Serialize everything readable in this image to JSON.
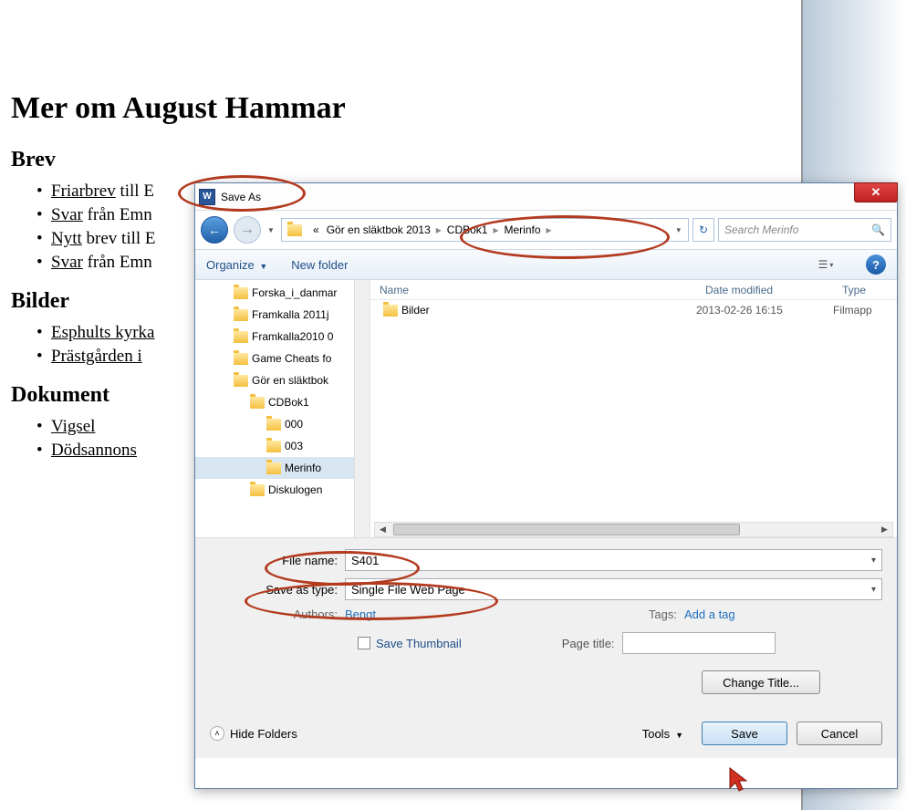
{
  "document": {
    "heading": "Mer om August Hammar",
    "section1": "Brev",
    "brev_items": [
      {
        "link": "Friarbrev",
        "rest": " till E"
      },
      {
        "link": "Svar",
        "rest": " från Emn"
      },
      {
        "link": "Nytt",
        "rest": " brev till E"
      },
      {
        "link": "Svar",
        "rest": " från Emn"
      }
    ],
    "section2": "Bilder",
    "bilder_items": [
      {
        "link": "Esphults kyrka",
        "rest": ""
      },
      {
        "link": "Prästgården i",
        "rest": ""
      }
    ],
    "section3": "Dokument",
    "dokument_items": [
      {
        "link": "Vigsel",
        "rest": ""
      },
      {
        "link": "Dödsannons",
        "rest": ""
      }
    ]
  },
  "dialog": {
    "title": "Save As",
    "close": "✕",
    "nav_back": "←",
    "nav_fwd": "→",
    "breadcrumb": {
      "prefix": "«",
      "seg1": "Gör en släktbok 2013",
      "seg2": "CDBok1",
      "seg3": "Merinfo"
    },
    "refresh": "↻",
    "search_placeholder": "Search Merinfo",
    "toolbar": {
      "organize": "Organize",
      "new_folder": "New folder",
      "help": "?"
    },
    "tree": [
      {
        "depth": "d1",
        "label": "Forska_i_danmar"
      },
      {
        "depth": "d1",
        "label": "Framkalla 2011j"
      },
      {
        "depth": "d1",
        "label": "Framkalla2010 0"
      },
      {
        "depth": "d1",
        "label": "Game Cheats fo"
      },
      {
        "depth": "d1",
        "label": "Gör en släktbok"
      },
      {
        "depth": "d2",
        "label": "CDBok1"
      },
      {
        "depth": "d3",
        "label": "000"
      },
      {
        "depth": "d3",
        "label": "003"
      },
      {
        "depth": "d3",
        "label": "Merinfo",
        "selected": true
      },
      {
        "depth": "d2",
        "label": "Diskulogen"
      }
    ],
    "filelist": {
      "col_name": "Name",
      "col_date": "Date modified",
      "col_type": "Type",
      "rows": [
        {
          "name": "Bilder",
          "date": "2013-02-26 16:15",
          "type": "Filmapp"
        }
      ]
    },
    "file_name_label": "File name:",
    "file_name_value": "S401",
    "save_type_label": "Save as type:",
    "save_type_value": "Single File Web Page",
    "authors_label": "Authors:",
    "authors_value": "Bengt",
    "tags_label": "Tags:",
    "tags_value": "Add a tag",
    "save_thumbnail": "Save Thumbnail",
    "page_title_label": "Page title:",
    "change_title": "Change Title...",
    "hide_folders": "Hide Folders",
    "tools": "Tools",
    "save": "Save",
    "cancel": "Cancel"
  }
}
